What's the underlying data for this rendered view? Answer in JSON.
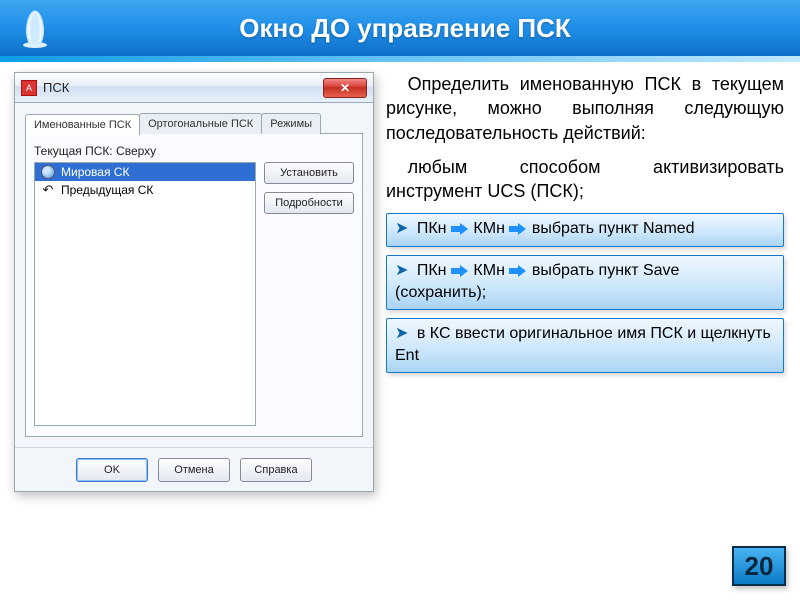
{
  "slide": {
    "title": "Окно ДО управление ПСК",
    "page_number": "20"
  },
  "text": {
    "para1": "Определить именованную ПСК в текущем рисунке, можно выполняя следующую последовательность действий:",
    "para2": "любым способом активизировать инструмент UCS (ПСК);"
  },
  "steps": {
    "s1_a": "ПКн",
    "s1_b": "КМн",
    "s1_c": "выбрать пункт Named",
    "s2_a": "ПКн",
    "s2_b": "КМн",
    "s2_c": "выбрать пункт Save (сохранить);",
    "s3": "в КС ввести оригинальное имя ПСК и щелкнуть Ent"
  },
  "dialog": {
    "title": "ПСК",
    "close": "✕",
    "tabs": {
      "t1": "Именованные ПСК",
      "t2": "Ортогональные ПСК",
      "t3": "Режимы"
    },
    "current_label": "Текущая ПСК: Сверху",
    "list": {
      "i1": "Мировая СК",
      "i2": "Предыдущая СК"
    },
    "side": {
      "b1": "Установить",
      "b2": "Подробности"
    },
    "footer": {
      "ok": "OK",
      "cancel": "Отмена",
      "help": "Справка"
    }
  }
}
